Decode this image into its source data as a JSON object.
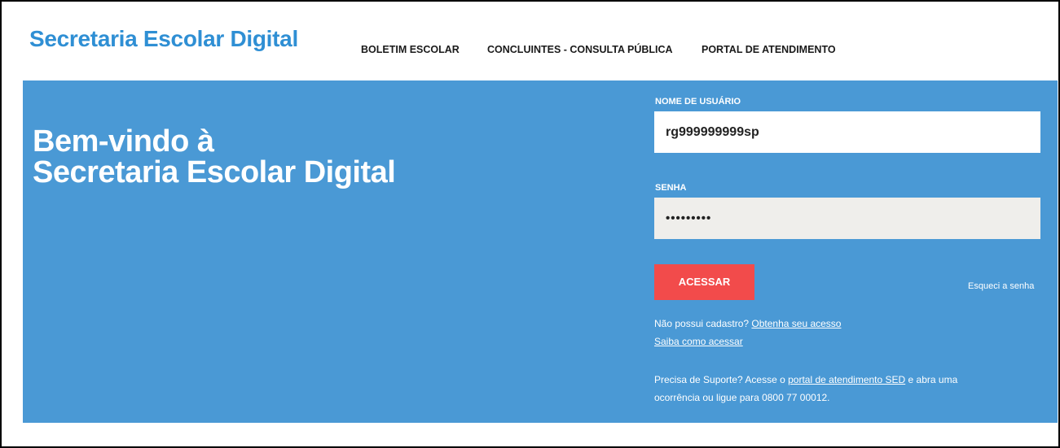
{
  "header": {
    "brand": "Secretaria Escolar Digital",
    "nav": [
      {
        "label": "BOLETIM ESCOLAR"
      },
      {
        "label": "CONCLUINTES - CONSULTA PÚBLICA"
      },
      {
        "label": "PORTAL DE ATENDIMENTO"
      }
    ]
  },
  "hero": {
    "welcome_line1": "Bem-vindo à",
    "welcome_line2": "Secretaria Escolar Digital"
  },
  "login": {
    "username_label": "NOME DE USUÁRIO",
    "username_value": "rg999999999sp",
    "password_label": "SENHA",
    "password_value": "•••••••••",
    "submit_label": "ACESSAR",
    "forgot_label": "Esqueci a senha",
    "no_account_text": "Não possui cadastro? ",
    "get_access_link": "Obtenha seu acesso",
    "how_access_link": "Saiba como acessar",
    "support_prefix": "Precisa de Suporte? Acesse o ",
    "support_link": "portal de atendimento SED",
    "support_suffix": " e abra uma",
    "support_line2": "ocorrência ou ligue para 0800 77 00012."
  },
  "colors": {
    "brand": "#2f8fd4",
    "hero_background": "#4a99d5",
    "submit_button": "#f24b4b"
  }
}
